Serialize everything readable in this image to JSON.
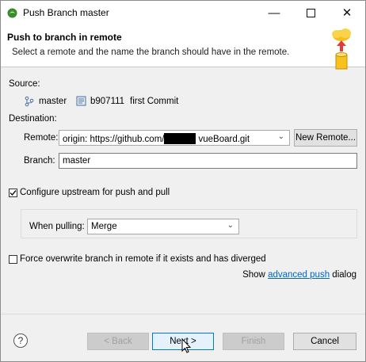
{
  "window": {
    "title": "Push Branch master",
    "minimize_icon": "minimize-icon",
    "maximize_icon": "maximize-icon",
    "close_icon": "close-icon"
  },
  "header": {
    "title": "Push to branch in remote",
    "description": "Select a remote and the name the branch should have in the remote."
  },
  "source": {
    "label": "Source:",
    "branch": "master",
    "commit_id": "b907111",
    "commit_message": "first Commit"
  },
  "destination": {
    "label": "Destination:",
    "remote_label": "Remote:",
    "remote_prefix": "origin: https://github.com/",
    "remote_suffix": "vueBoard.git",
    "new_remote_button": "New Remote...",
    "branch_label": "Branch:",
    "branch_value": "master"
  },
  "upstream": {
    "label": "Configure upstream for push and pull",
    "checked": true,
    "when_pulling_label": "When pulling:",
    "when_pulling_value": "Merge"
  },
  "force": {
    "label": "Force overwrite branch in remote if it exists and has diverged",
    "checked": false
  },
  "advanced": {
    "prefix": "Show",
    "link": "advanced push",
    "suffix": "dialog"
  },
  "buttons": {
    "back": "< Back",
    "next": "Next >",
    "finish": "Finish",
    "cancel": "Cancel"
  },
  "colors": {
    "accent": "#0078d7",
    "link": "#0066cc"
  }
}
